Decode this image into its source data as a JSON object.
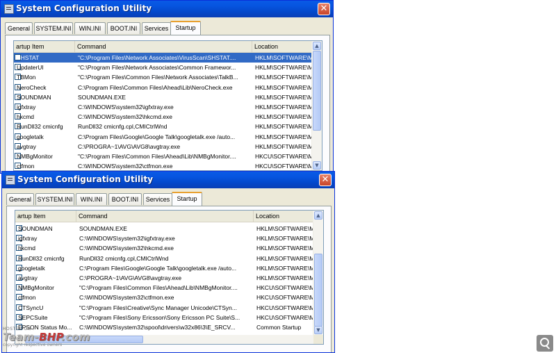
{
  "window_title": "System Configuration Utility",
  "close_glyph": "✕",
  "tabs": [
    "General",
    "SYSTEM.INI",
    "WIN.INI",
    "BOOT.INI",
    "Services",
    "Startup"
  ],
  "active_tab": "Startup",
  "columns": [
    "artup Item",
    "Command",
    "Location"
  ],
  "window1_rows": [
    {
      "item": "SHSTAT",
      "command": "\"C:\\Program Files\\Network Associates\\VirusScan\\SHSTAT....",
      "location": "HKLM\\SOFTWARE\\M",
      "selected": true
    },
    {
      "item": "UpdaterUI",
      "command": "\"C:\\Program Files\\Network Associates\\Common Framewor...",
      "location": "HKLM\\SOFTWARE\\M"
    },
    {
      "item": "TBMon",
      "command": "\"C:\\Program Files\\Common Files\\Network Associates\\TalkB...",
      "location": "HKLM\\SOFTWARE\\M"
    },
    {
      "item": "NeroCheck",
      "command": "C:\\Program Files\\Common Files\\Ahead\\Lib\\NeroCheck.exe",
      "location": "HKLM\\SOFTWARE\\M"
    },
    {
      "item": "SOUNDMAN",
      "command": "SOUNDMAN.EXE",
      "location": "HKLM\\SOFTWARE\\M"
    },
    {
      "item": "igfxtray",
      "command": "C:\\WINDOWS\\system32\\igfxtray.exe",
      "location": "HKLM\\SOFTWARE\\M"
    },
    {
      "item": "hkcmd",
      "command": "C:\\WINDOWS\\system32\\hkcmd.exe",
      "location": "HKLM\\SOFTWARE\\M"
    },
    {
      "item": "RunDll32 cmicnfg",
      "command": "RunDll32 cmicnfg.cpl,CMICtrlWnd",
      "location": "HKLM\\SOFTWARE\\M"
    },
    {
      "item": "googletalk",
      "command": "C:\\Program Files\\Google\\Google Talk\\googletalk.exe /auto...",
      "location": "HKLM\\SOFTWARE\\M"
    },
    {
      "item": "avgtray",
      "command": "C:\\PROGRA~1\\AVG\\AVG8\\avgtray.exe",
      "location": "HKLM\\SOFTWARE\\M"
    },
    {
      "item": "NMBgMonitor",
      "command": "\"C:\\Program Files\\Common Files\\Ahead\\Lib\\NMBgMonitor....",
      "location": "HKCU\\SOFTWARE\\M"
    },
    {
      "item": "ctfmon",
      "command": "C:\\WINDOWS\\system32\\ctfmon.exe",
      "location": "HKCU\\SOFTWARE\\M"
    }
  ],
  "window2_rows": [
    {
      "item": "SOUNDMAN",
      "command": "SOUNDMAN.EXE",
      "location": "HKLM\\SOFTWARE\\M"
    },
    {
      "item": "igfxtray",
      "command": "C:\\WINDOWS\\system32\\igfxtray.exe",
      "location": "HKLM\\SOFTWARE\\M"
    },
    {
      "item": "hkcmd",
      "command": "C:\\WINDOWS\\system32\\hkcmd.exe",
      "location": "HKLM\\SOFTWARE\\M"
    },
    {
      "item": "RunDll32 cmicnfg",
      "command": "RunDll32 cmicnfg.cpl,CMICtrlWnd",
      "location": "HKLM\\SOFTWARE\\M"
    },
    {
      "item": "googletalk",
      "command": "C:\\Program Files\\Google\\Google Talk\\googletalk.exe /auto...",
      "location": "HKLM\\SOFTWARE\\M"
    },
    {
      "item": "avgtray",
      "command": "C:\\PROGRA~1\\AVG\\AVG8\\avgtray.exe",
      "location": "HKLM\\SOFTWARE\\M"
    },
    {
      "item": "NMBgMonitor",
      "command": "\"C:\\Program Files\\Common Files\\Ahead\\Lib\\NMBgMonitor....",
      "location": "HKCU\\SOFTWARE\\M"
    },
    {
      "item": "ctfmon",
      "command": "C:\\WINDOWS\\system32\\ctfmon.exe",
      "location": "HKCU\\SOFTWARE\\M"
    },
    {
      "item": "CTSyncU",
      "command": "\"C:\\Program Files\\Creative\\Sync Manager Unicode\\CTSyn...",
      "location": "HKCU\\SOFTWARE\\M"
    },
    {
      "item": "SEPCSuite",
      "command": "\"C:\\Program Files\\Sony Ericsson\\Sony Ericsson PC Suite\\S...",
      "location": "HKCU\\SOFTWARE\\M"
    },
    {
      "item": "EPSON Status Mo...",
      "command": "C:\\WINDOWS\\system32\\spool\\drivers\\w32x86\\3\\E_SRCV...",
      "location": "Common Startup"
    }
  ],
  "watermark": {
    "hosted": "HOSTED ON :",
    "logo_main": "Team-",
    "logo_red": "BHP",
    "logo_end": ".com",
    "copyright": "copyright respective owners"
  },
  "icons": {
    "zoom": "magnifier-zoom-icon",
    "app": "system-config-app-icon"
  }
}
